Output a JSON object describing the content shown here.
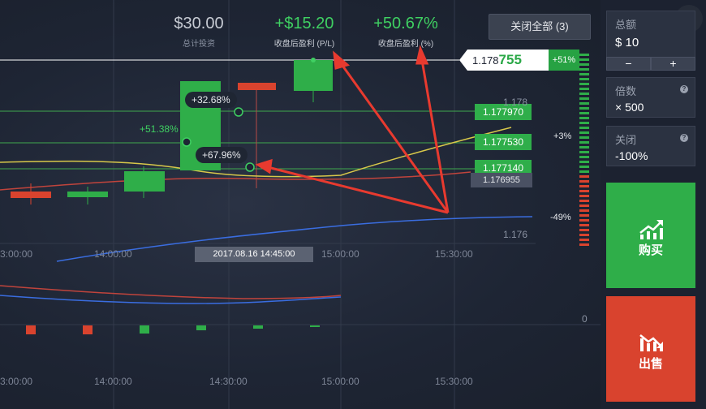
{
  "header": {
    "invest_value": "$30.00",
    "invest_label": "总计投资",
    "pl_value": "+$15.20",
    "pl_label": "收盘后盈利 (P/L)",
    "pct_value": "+50.67%",
    "pct_label": "收盘后盈利 (%)",
    "close_all": "关闭全部 (3)"
  },
  "current_price": {
    "prefix": "1.178",
    "big": "755",
    "pct": "+51%"
  },
  "levels": [
    {
      "price": "1.177970"
    },
    {
      "price": "1.177530"
    },
    {
      "price": "1.177140"
    },
    {
      "price": "1.176955"
    }
  ],
  "axis": {
    "y_top": "1.178",
    "y_bottom": "1.176",
    "zero": "0"
  },
  "right_pcts": {
    "plus": "+3%",
    "minus": "-49%"
  },
  "bubbles": {
    "b1": "+32.68%",
    "b2": "+67.96%",
    "side": "+51.38%"
  },
  "time_axis": {
    "top": [
      "3:00:00",
      "14:00:00",
      "15:00:00",
      "15:30:00"
    ],
    "bottom": [
      "3:00:00",
      "14:00:00",
      "14:30:00",
      "15:00:00",
      "15:30:00"
    ]
  },
  "date_label": "2017.08.16 14:45:00",
  "panel": {
    "amount_title": "总额",
    "amount_value": "$ 10",
    "minus": "−",
    "plus": "+",
    "multiplier_title": "倍数",
    "multiplier_value": "× 500",
    "close_title": "关闭",
    "close_value": "-100%",
    "help": "?"
  },
  "buy_label": "购买",
  "sell_label": "出售",
  "colors": {
    "green": "#2fae49",
    "red": "#d9432e",
    "blue": "#3a6de0",
    "yellow": "#d8c84a"
  },
  "icons": [
    "close-icon",
    "trend-up-icon",
    "trend-down-icon",
    "help-icon"
  ]
}
